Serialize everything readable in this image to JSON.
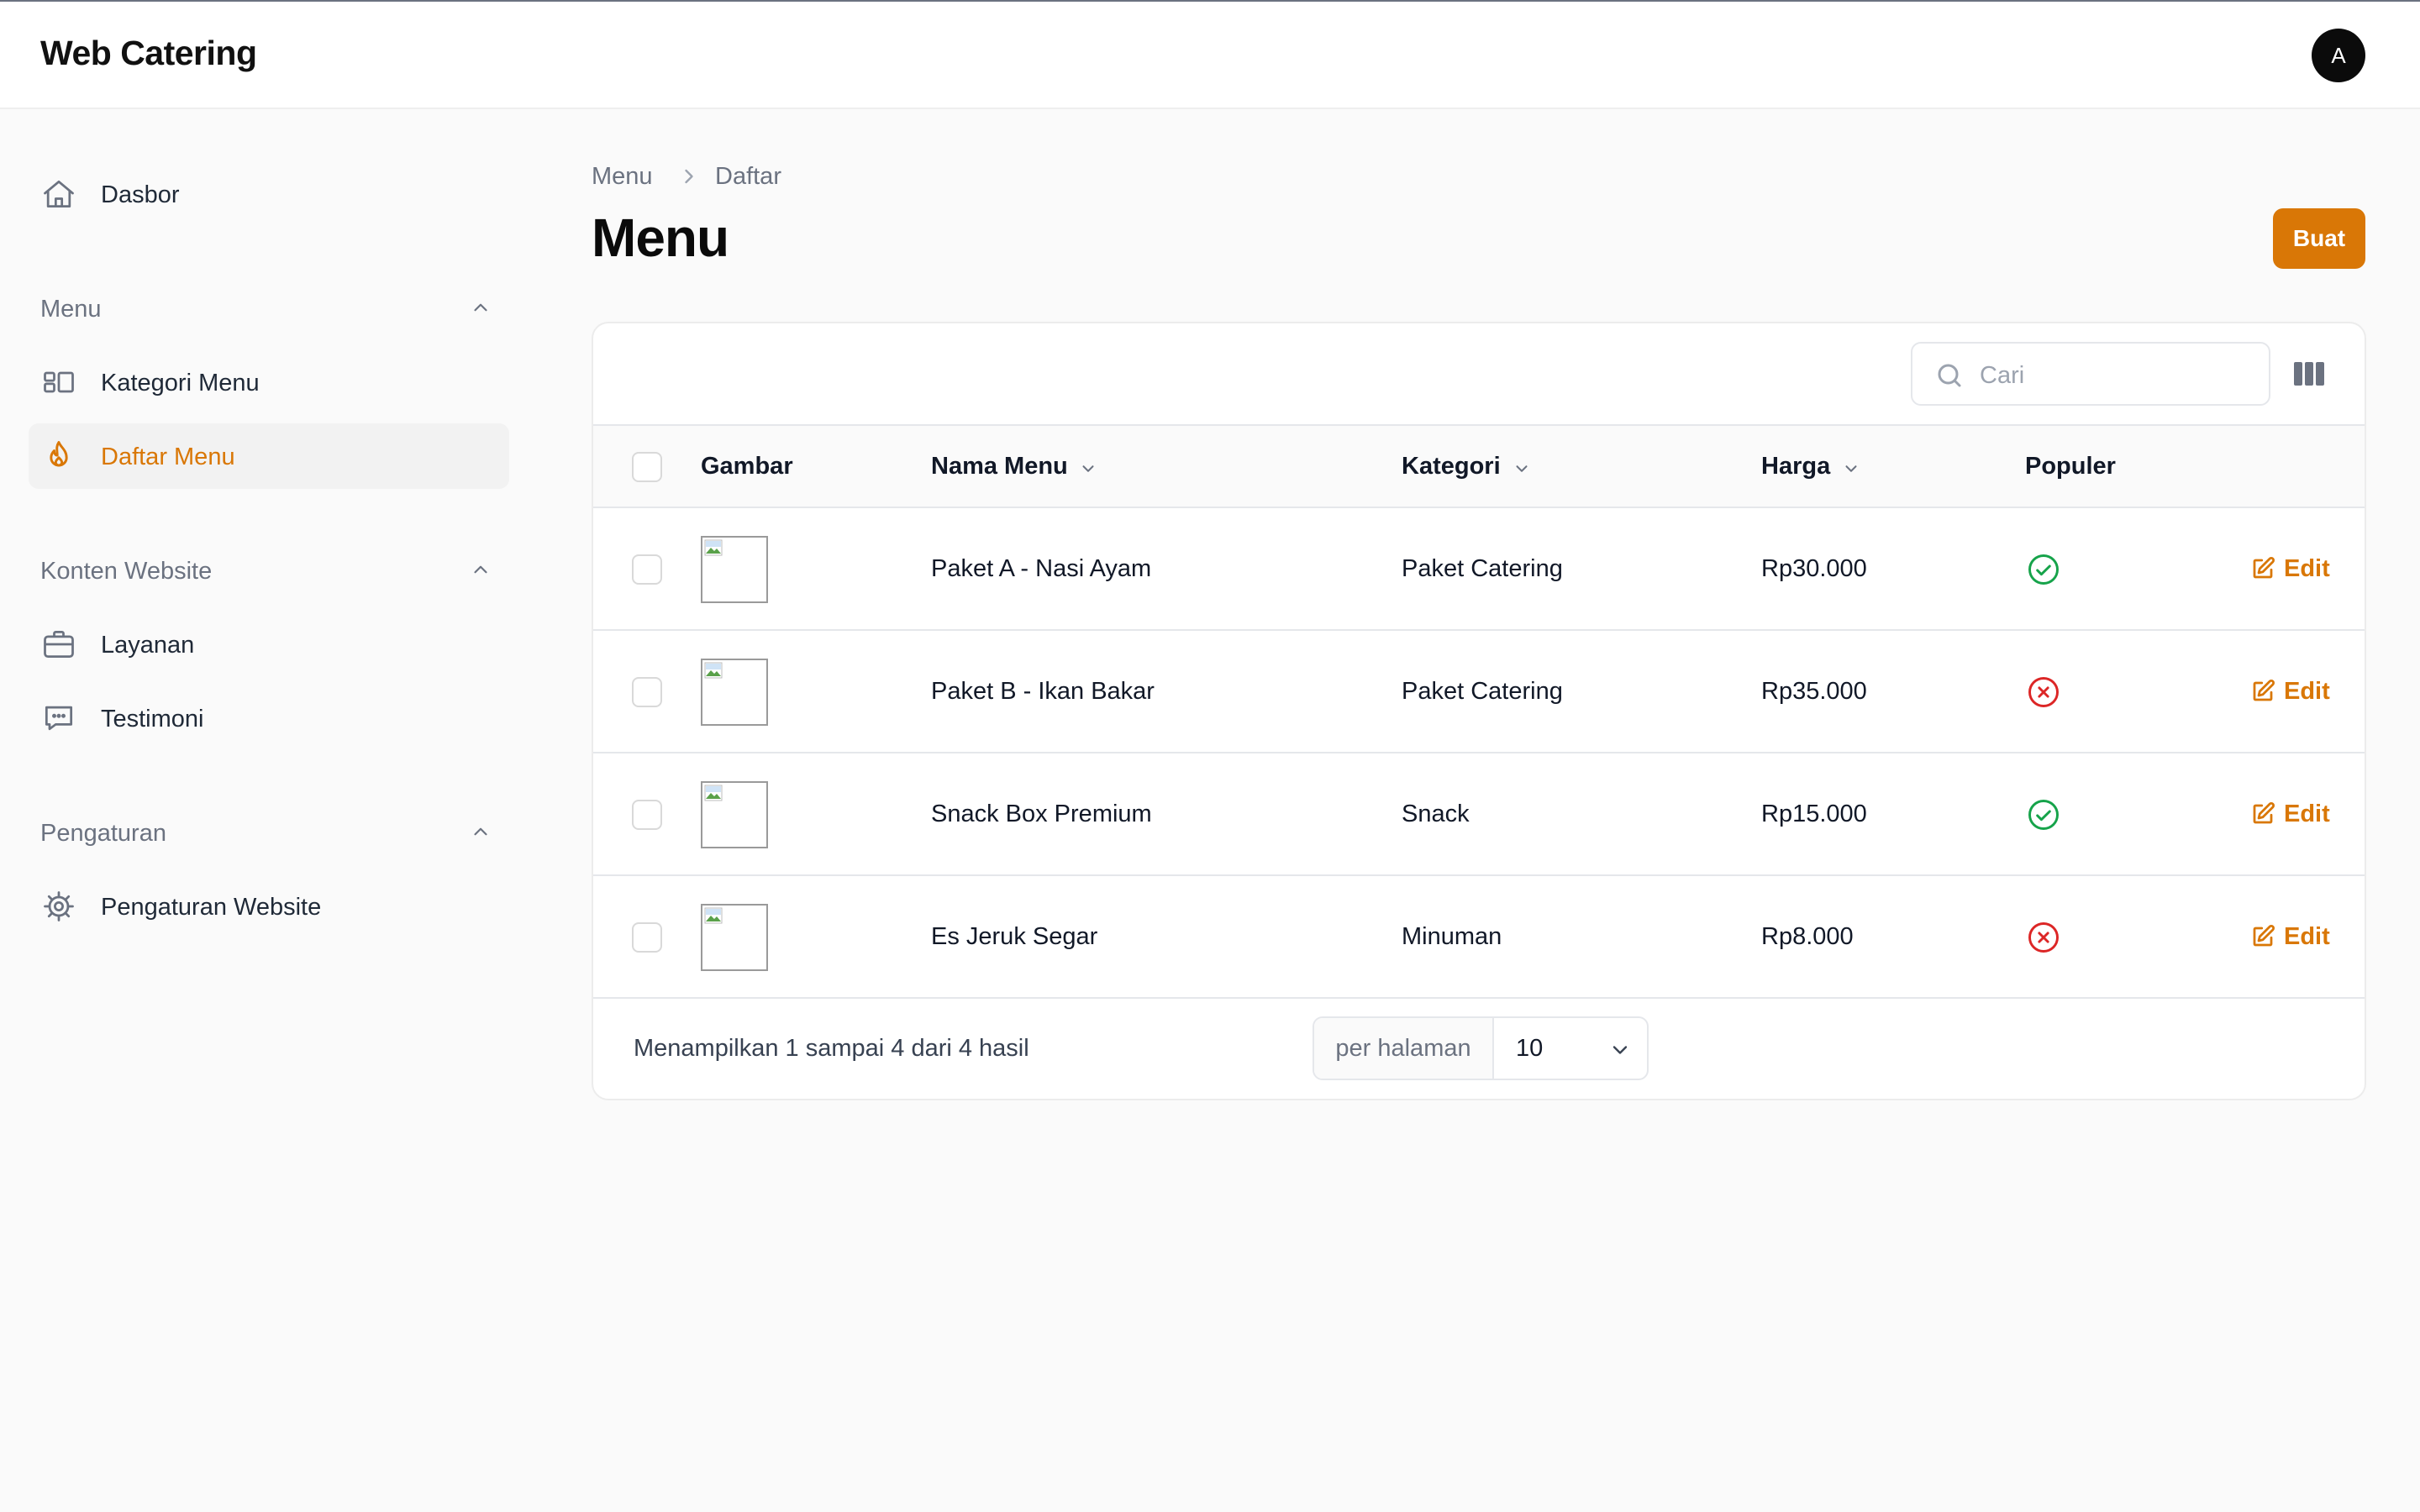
{
  "app": {
    "brand": "Web Catering",
    "avatar_initial": "A"
  },
  "sidebar": {
    "dashboard": {
      "label": "Dasbor",
      "icon": "home-icon"
    },
    "groups": [
      {
        "label": "Menu",
        "items": [
          {
            "label": "Kategori Menu",
            "icon": "layout-icon"
          },
          {
            "label": "Daftar Menu",
            "icon": "fire-icon",
            "active": true
          }
        ]
      },
      {
        "label": "Konten Website",
        "items": [
          {
            "label": "Layanan",
            "icon": "briefcase-icon"
          },
          {
            "label": "Testimoni",
            "icon": "chat-icon"
          }
        ]
      },
      {
        "label": "Pengaturan",
        "items": [
          {
            "label": "Pengaturan Website",
            "icon": "gear-icon"
          }
        ]
      }
    ]
  },
  "breadcrumb": [
    "Menu",
    "Daftar"
  ],
  "page": {
    "title": "Menu",
    "create_label": "Buat"
  },
  "search": {
    "placeholder": "Cari"
  },
  "table": {
    "columns": [
      "Gambar",
      "Nama Menu",
      "Kategori",
      "Harga",
      "Populer"
    ],
    "edit_label": "Edit",
    "rows": [
      {
        "name": "Paket A - Nasi Ayam",
        "category": "Paket Catering",
        "price": "Rp30.000",
        "popular": true
      },
      {
        "name": "Paket B - Ikan Bakar",
        "category": "Paket Catering",
        "price": "Rp35.000",
        "popular": false
      },
      {
        "name": "Snack Box Premium",
        "category": "Snack",
        "price": "Rp15.000",
        "popular": true
      },
      {
        "name": "Es Jeruk Segar",
        "category": "Minuman",
        "price": "Rp8.000",
        "popular": false
      }
    ]
  },
  "footer": {
    "summary": "Menampilkan 1 sampai 4 dari 4 hasil",
    "per_page_label": "per halaman",
    "per_page_value": "10"
  },
  "colors": {
    "accent": "#d97706",
    "success": "#16a34a",
    "danger": "#dc2626"
  }
}
